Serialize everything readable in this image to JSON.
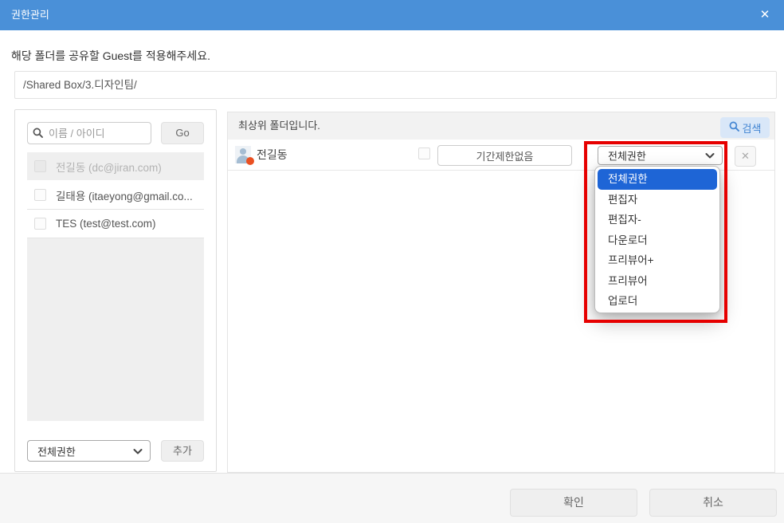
{
  "window": {
    "title": "권한관리",
    "close_icon": "✕"
  },
  "intro": {
    "text": "해당 폴더를 공유할 Guest를 적용해주세요."
  },
  "path": {
    "value": "/Shared Box/3.디자인팀/"
  },
  "left_panel": {
    "search": {
      "placeholder": "이름 / 아이디",
      "go_label": "Go"
    },
    "users": [
      {
        "label": "전길동 (dc@jiran.com)"
      },
      {
        "label": "길태용 (itaeyong@gmail.co..."
      },
      {
        "label": "TES (test@test.com)"
      }
    ],
    "permission_select": {
      "value": "전체권한"
    },
    "add_label": "추가"
  },
  "right_panel": {
    "header": {
      "message": "최상위 폴더입니다.",
      "search_label": "검색"
    },
    "guest_row": {
      "name": "전길동",
      "period_label": "기간제한없음",
      "permission_value": "전체권한",
      "remove_icon": "✕"
    },
    "dropdown_options": [
      "전체권한",
      "편집자",
      "편집자-",
      "다운로더",
      "프리뷰어+",
      "프리뷰어",
      "업로더"
    ],
    "dropdown_selected": "전체권한"
  },
  "footer": {
    "confirm_label": "확인",
    "cancel_label": "취소"
  },
  "colors": {
    "titlebar": "#4a90d8",
    "dropdown_highlight": "#1e65d6",
    "annotation": "#e60000",
    "search_button_bg": "#d9e7f8",
    "search_button_text": "#4285d2",
    "avatar_badge": "#ea5022"
  }
}
